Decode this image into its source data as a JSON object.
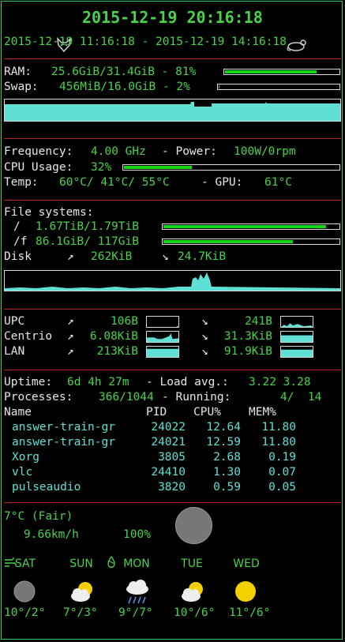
{
  "header": {
    "datetime": "2015-12-19 20:16:18",
    "range": "2015-12-19 11:16:18 - 2015-12-19 14:16:18"
  },
  "memory": {
    "ram_label": "RAM:",
    "ram_value": "25.6GiB/31.4GiB - 81%",
    "ram_percent": 81,
    "swap_label": "Swap:",
    "swap_value": "456MiB/16.0GiB - 2%",
    "swap_percent": 2
  },
  "cpu": {
    "freq_label": "Frequency:",
    "freq_value": "4.00 GHz",
    "power_label": "- Power:",
    "power_value": "100W/0rpm",
    "usage_label": "CPU Usage:",
    "usage_value": "32%",
    "usage_percent": 32,
    "temp_label": "Temp:",
    "temp_values": "60°C/ 41°C/ 55°C",
    "gpu_label": "- GPU:",
    "gpu_value": "61°C"
  },
  "fs": {
    "title": "File systems:",
    "items": [
      {
        "mount": "/",
        "value": "1.67TiB/1.79TiB",
        "percent": 93
      },
      {
        "mount": "/f",
        "value": "86.1GiB/ 117GiB",
        "percent": 74
      }
    ],
    "disk_label": "Disk",
    "disk_read": "262KiB",
    "disk_write": "24.7KiB",
    "up_arrow": "↗",
    "down_arrow": "↘"
  },
  "net": {
    "rows": [
      {
        "name": "UPC",
        "up": "106B",
        "down": "241B"
      },
      {
        "name": "Centrio",
        "up": "6.08KiB",
        "down": "31.3KiB"
      },
      {
        "name": "LAN",
        "up": "213KiB",
        "down": "91.9KiB"
      }
    ]
  },
  "system": {
    "uptime_label": "Uptime:",
    "uptime_value": "6d 4h 27m",
    "load_label": "- Load avg.:",
    "load_value": "3.22 3.28",
    "proc_label": "Processes:",
    "proc_value": "366/1044",
    "running_label": "- Running:",
    "running_value": "4/  14"
  },
  "processes": {
    "headers": [
      "Name",
      "PID",
      "CPU%",
      "MEM%"
    ],
    "rows": [
      [
        "answer-train-gr",
        "24022",
        "12.64",
        "11.80"
      ],
      [
        "answer-train-gr",
        "24021",
        "12.59",
        "11.80"
      ],
      [
        "Xorg",
        "3805",
        "2.68",
        "0.19"
      ],
      [
        "vlc",
        "24410",
        "1.30",
        "0.07"
      ],
      [
        "pulseaudio",
        "3820",
        "0.59",
        "0.05"
      ]
    ]
  },
  "weather": {
    "current": "7°C (Fair)",
    "wind": "9.66km/h",
    "humidity": "100%",
    "forecast": [
      {
        "day": "SAT",
        "temp": "10°/2°",
        "icon": "moon-icon"
      },
      {
        "day": "SUN",
        "temp": "7°/3°",
        "icon": "partly-cloudy-icon"
      },
      {
        "day": "MON",
        "temp": "9°/7°",
        "icon": "rain-cloud-icon"
      },
      {
        "day": "TUE",
        "temp": "10°/6°",
        "icon": "partly-cloudy-icon"
      },
      {
        "day": "WED",
        "temp": "11°/6°",
        "icon": "sun-icon"
      }
    ]
  },
  "colors": {
    "accent": "#4ad24a",
    "separator": "#b52020",
    "graph": "#5fe0d4",
    "bar": "#13d813"
  }
}
